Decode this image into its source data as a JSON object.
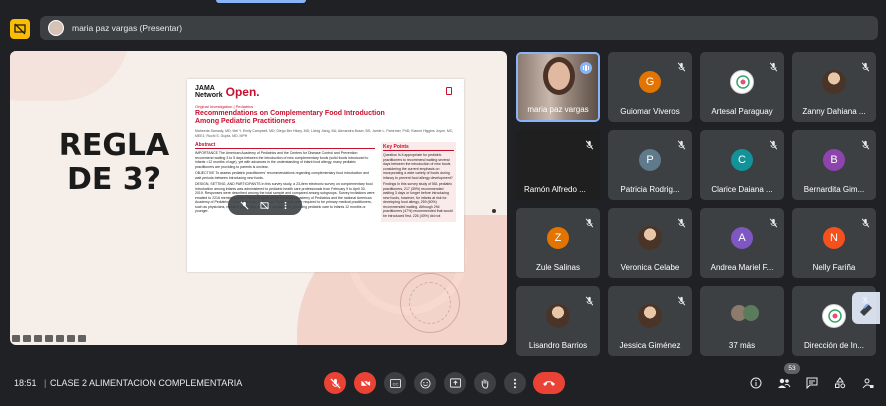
{
  "presenter_bar": {
    "label": "maria paz vargas (Presentar)"
  },
  "slide": {
    "headline": "REGLA\nDE 3?",
    "paper": {
      "journal_small": "JAMA\nNetwork",
      "journal_big": "Open.",
      "tag": "Original Investigation | Pediatrics",
      "title": "Recommendations on Complementary Food Introduction Among Pediatric Practitioners",
      "authors": "Maheeda Samady, MD; Mel Y. Emily Campbell, MD; Diego Ber Hilary, MD; Lizbig Jiang, BA; Alexandra Buser, BS; Jamie L. Pamrmer, PhD; Kianne Higgins Joyce, MC; MEE1; Ruchi S. Gupta, MD, MPH",
      "abstract_heading": "Abstract",
      "abstract_importance": "IMPORTANCE The American Academy of Pediatrics and the Centers for Disease Control and Prevention recommend waiting 3 to 5 days between the introduction of new complementary foods (solid foods introduced to infants <12 months of age), yet with advances in the understanding of infant food allergy, many pediatric practitioners are providing to parents is unclear.",
      "abstract_objective": "OBJECTIVE To assess pediatric practitioners' recommendations regarding complementary food introduction and wait periods between introducing new foods.",
      "abstract_design": "DESIGN, SETTING, AND PARTICIPANTS In this survey study, a 23-item electronic survey on complementary food introduction among infants was administered to pediatric health care professionals from February 9 to April 30, 2019. Responses were described among the total sample and compared among subgroups. Survey invitations were emailed to 2216 members of the Illinois Chapter of the American Academy of Pediatrics and the national American Academy of Pediatrics' Council on Early Childhood. Participants were required to be primary medical practitioners, such as physicians, resident physicians, or nurse practitioners, providing pediatric care to infants 12 months or younger.",
      "key_heading": "Key Points",
      "key_question": "Question Is it appropriate for pediatric practitioners to recommend waiting several days between the introduction of new foods considering the current emphasis on incorporating a wide variety of foods during infancy to prevent food allergy development?",
      "key_findings": "Findings In this survey study of 561 pediatric practitioners, 217 (39%) recommended waiting 3 days or longer before introducing new foods, however, for infants at risk for developing food allergy, 259 (60%) recommended waiting. Although 294 practitioners (47%) recommended that would be introduced first, 226 (40%) did not"
    }
  },
  "participants": [
    {
      "name": "maria paz vargas",
      "type": "video",
      "speaking": true
    },
    {
      "name": "Guiomar Viveros",
      "type": "letter",
      "letter": "G",
      "color": "#e37400"
    },
    {
      "name": "Artesal Paraguay",
      "type": "logo"
    },
    {
      "name": "Zanny Dahiana ...",
      "type": "photo"
    },
    {
      "name": "Ramón Alfredo ...",
      "type": "blank"
    },
    {
      "name": "Patricia Rodrig...",
      "type": "letter",
      "letter": "P",
      "color": "#5f7a8a"
    },
    {
      "name": "Clarice Daiana ...",
      "type": "letter",
      "letter": "C",
      "color": "#12939a"
    },
    {
      "name": "Bernardita Gim...",
      "type": "letter",
      "letter": "B",
      "color": "#8e44ad"
    },
    {
      "name": "Zule Salinas",
      "type": "letter",
      "letter": "Z",
      "color": "#e37400"
    },
    {
      "name": "Veronica Celabe",
      "type": "photo"
    },
    {
      "name": "Andrea Mariel F...",
      "type": "letter",
      "letter": "A",
      "color": "#7e57c2"
    },
    {
      "name": "Nelly Fariña",
      "type": "letter",
      "letter": "N",
      "color": "#f4511e"
    },
    {
      "name": "Lisandro Barrios",
      "type": "photo"
    },
    {
      "name": "Jessica Giménez",
      "type": "photo"
    },
    {
      "name": "37 más",
      "type": "more"
    },
    {
      "name": "Dirección de In...",
      "type": "logo"
    }
  ],
  "bottom_bar": {
    "time": "18:51",
    "separator": "|",
    "meeting_title": "CLASE 2 ALIMENTACION COMPLEMENTARIA",
    "participants_count": "53"
  },
  "colors": {
    "accent": "#8ab4f8",
    "danger": "#ea4335",
    "warning": "#fbbc04",
    "tile": "#3c4043",
    "background": "#202124"
  }
}
